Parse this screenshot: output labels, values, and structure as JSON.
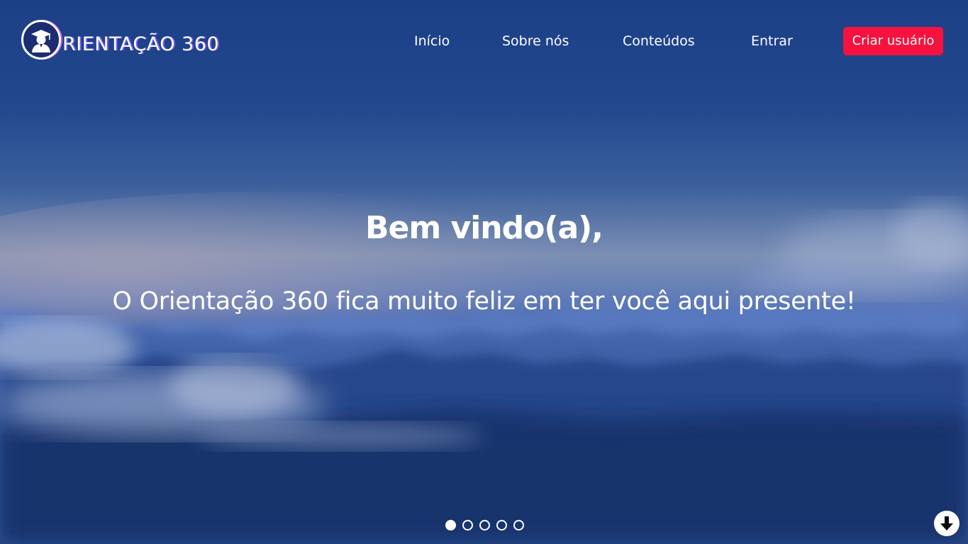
{
  "brand": {
    "logo_text": "RIENTAÇÃO 360"
  },
  "nav": {
    "items": [
      {
        "label": "Início"
      },
      {
        "label": "Sobre nós"
      },
      {
        "label": "Conteúdos"
      },
      {
        "label": "Entrar"
      }
    ],
    "cta_label": "Criar usuário"
  },
  "hero": {
    "title": "Bem vindo(a),",
    "subtitle": "O Orientação 360 fica muito feliz em ter você aqui presente!"
  },
  "carousel": {
    "slide_count": 5,
    "active_index": 0
  },
  "colors": {
    "accent": "#f5123e",
    "text": "#ffffff",
    "sky_top": "#1c3f86",
    "sky_bottom": "#152a5e"
  },
  "icons": {
    "logo": "graduate-icon",
    "scroll": "arrow-down-icon"
  }
}
